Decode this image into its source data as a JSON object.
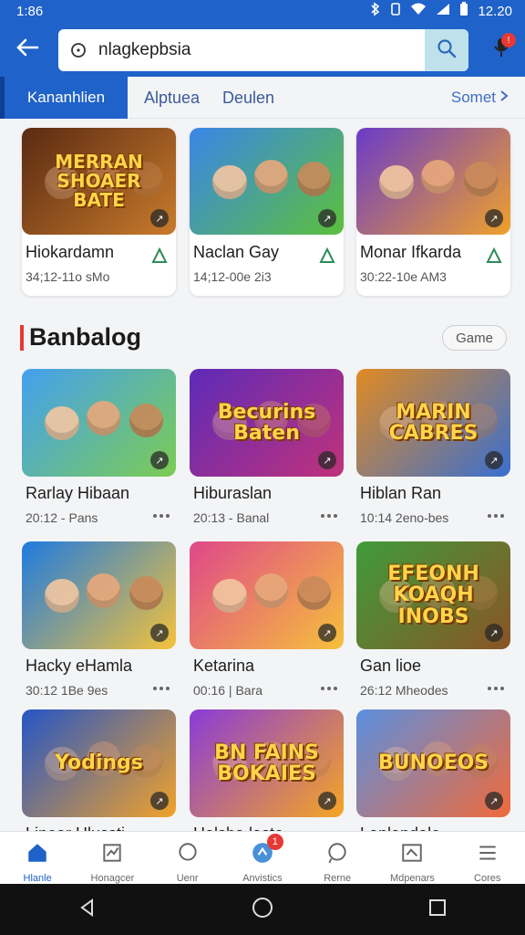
{
  "status": {
    "time": "1:86",
    "clock": "12.20"
  },
  "search": {
    "value": "nlagkepbsia"
  },
  "mic_badge": "!",
  "tabs": {
    "active": "Kananhlien",
    "t2": "Alptuea",
    "t3": "Deulen",
    "more": "Somet"
  },
  "featured": [
    {
      "title": "Hiokardamn",
      "meta": "34;12-11o sMo",
      "thumb_text": "MERRAN SHOAER BATE",
      "colors": [
        "#5a2a12",
        "#c97b2c"
      ]
    },
    {
      "title": "Naclan Gay",
      "meta": "14;12-00e 2i3",
      "thumb_text": "",
      "colors": [
        "#3a86e8",
        "#5cbf3c"
      ]
    },
    {
      "title": "Monar Ifkarda",
      "meta": "30:22-10e AM3",
      "thumb_text": "",
      "colors": [
        "#6a3bc9",
        "#f0a12a"
      ]
    }
  ],
  "section": {
    "title": "Banbalog",
    "button": "Game"
  },
  "grid": [
    {
      "title": "Rarlay Hibaan",
      "meta": "20:12 - Pans",
      "thumb_text": "",
      "colors": [
        "#43a0f0",
        "#7ccc52"
      ]
    },
    {
      "title": "Hiburaslan",
      "meta": "20:13 - Banal",
      "thumb_text": "Becurins Baten",
      "colors": [
        "#5e2ab8",
        "#c0327a"
      ]
    },
    {
      "title": "Hiblan Ran",
      "meta": "10:14 2eno-bes",
      "thumb_text": "MARIN CABRES",
      "colors": [
        "#e08a22",
        "#3a6fd0"
      ]
    },
    {
      "title": "Hacky eHamla",
      "meta": "30:12 1Be 9es",
      "thumb_text": "",
      "colors": [
        "#1e7be0",
        "#f5c23a"
      ]
    },
    {
      "title": "Ketarina",
      "meta": "00:16 | Bara",
      "thumb_text": "",
      "colors": [
        "#e0478a",
        "#f6c13b"
      ]
    },
    {
      "title": "Gan lioe",
      "meta": "26:12 Mheodes",
      "thumb_text": "EFEONH KOAQH INOBS",
      "colors": [
        "#3f9c3a",
        "#8a5424"
      ]
    },
    {
      "title": "Linear Hlussti",
      "meta": "",
      "thumb_text": "Yodings",
      "colors": [
        "#2455c6",
        "#f2a22a"
      ]
    },
    {
      "title": "Halsha lasto",
      "meta": "",
      "thumb_text": "BN FAINS BOKAIES",
      "colors": [
        "#8a3bd8",
        "#f5a623"
      ]
    },
    {
      "title": "Lanlandale",
      "meta": "",
      "thumb_text": "BUNOEOS",
      "colors": [
        "#5b8fe0",
        "#f06a3a"
      ]
    }
  ],
  "nav": [
    {
      "label": "Hlanle"
    },
    {
      "label": "Honagcer"
    },
    {
      "label": "Uenr"
    },
    {
      "label": "Anvistics",
      "badge": "1"
    },
    {
      "label": "Rerne"
    },
    {
      "label": "Mdpenars"
    },
    {
      "label": "Cores"
    }
  ]
}
